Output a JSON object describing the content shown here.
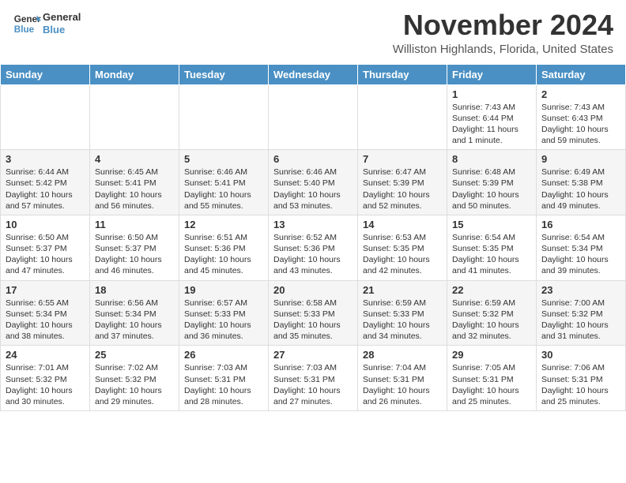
{
  "header": {
    "logo_line1": "General",
    "logo_line2": "Blue",
    "month": "November 2024",
    "location": "Williston Highlands, Florida, United States"
  },
  "weekdays": [
    "Sunday",
    "Monday",
    "Tuesday",
    "Wednesday",
    "Thursday",
    "Friday",
    "Saturday"
  ],
  "weeks": [
    [
      {
        "day": "",
        "content": ""
      },
      {
        "day": "",
        "content": ""
      },
      {
        "day": "",
        "content": ""
      },
      {
        "day": "",
        "content": ""
      },
      {
        "day": "",
        "content": ""
      },
      {
        "day": "1",
        "content": "Sunrise: 7:43 AM\nSunset: 6:44 PM\nDaylight: 11 hours and 1 minute."
      },
      {
        "day": "2",
        "content": "Sunrise: 7:43 AM\nSunset: 6:43 PM\nDaylight: 10 hours and 59 minutes."
      }
    ],
    [
      {
        "day": "3",
        "content": "Sunrise: 6:44 AM\nSunset: 5:42 PM\nDaylight: 10 hours and 57 minutes."
      },
      {
        "day": "4",
        "content": "Sunrise: 6:45 AM\nSunset: 5:41 PM\nDaylight: 10 hours and 56 minutes."
      },
      {
        "day": "5",
        "content": "Sunrise: 6:46 AM\nSunset: 5:41 PM\nDaylight: 10 hours and 55 minutes."
      },
      {
        "day": "6",
        "content": "Sunrise: 6:46 AM\nSunset: 5:40 PM\nDaylight: 10 hours and 53 minutes."
      },
      {
        "day": "7",
        "content": "Sunrise: 6:47 AM\nSunset: 5:39 PM\nDaylight: 10 hours and 52 minutes."
      },
      {
        "day": "8",
        "content": "Sunrise: 6:48 AM\nSunset: 5:39 PM\nDaylight: 10 hours and 50 minutes."
      },
      {
        "day": "9",
        "content": "Sunrise: 6:49 AM\nSunset: 5:38 PM\nDaylight: 10 hours and 49 minutes."
      }
    ],
    [
      {
        "day": "10",
        "content": "Sunrise: 6:50 AM\nSunset: 5:37 PM\nDaylight: 10 hours and 47 minutes."
      },
      {
        "day": "11",
        "content": "Sunrise: 6:50 AM\nSunset: 5:37 PM\nDaylight: 10 hours and 46 minutes."
      },
      {
        "day": "12",
        "content": "Sunrise: 6:51 AM\nSunset: 5:36 PM\nDaylight: 10 hours and 45 minutes."
      },
      {
        "day": "13",
        "content": "Sunrise: 6:52 AM\nSunset: 5:36 PM\nDaylight: 10 hours and 43 minutes."
      },
      {
        "day": "14",
        "content": "Sunrise: 6:53 AM\nSunset: 5:35 PM\nDaylight: 10 hours and 42 minutes."
      },
      {
        "day": "15",
        "content": "Sunrise: 6:54 AM\nSunset: 5:35 PM\nDaylight: 10 hours and 41 minutes."
      },
      {
        "day": "16",
        "content": "Sunrise: 6:54 AM\nSunset: 5:34 PM\nDaylight: 10 hours and 39 minutes."
      }
    ],
    [
      {
        "day": "17",
        "content": "Sunrise: 6:55 AM\nSunset: 5:34 PM\nDaylight: 10 hours and 38 minutes."
      },
      {
        "day": "18",
        "content": "Sunrise: 6:56 AM\nSunset: 5:34 PM\nDaylight: 10 hours and 37 minutes."
      },
      {
        "day": "19",
        "content": "Sunrise: 6:57 AM\nSunset: 5:33 PM\nDaylight: 10 hours and 36 minutes."
      },
      {
        "day": "20",
        "content": "Sunrise: 6:58 AM\nSunset: 5:33 PM\nDaylight: 10 hours and 35 minutes."
      },
      {
        "day": "21",
        "content": "Sunrise: 6:59 AM\nSunset: 5:33 PM\nDaylight: 10 hours and 34 minutes."
      },
      {
        "day": "22",
        "content": "Sunrise: 6:59 AM\nSunset: 5:32 PM\nDaylight: 10 hours and 32 minutes."
      },
      {
        "day": "23",
        "content": "Sunrise: 7:00 AM\nSunset: 5:32 PM\nDaylight: 10 hours and 31 minutes."
      }
    ],
    [
      {
        "day": "24",
        "content": "Sunrise: 7:01 AM\nSunset: 5:32 PM\nDaylight: 10 hours and 30 minutes."
      },
      {
        "day": "25",
        "content": "Sunrise: 7:02 AM\nSunset: 5:32 PM\nDaylight: 10 hours and 29 minutes."
      },
      {
        "day": "26",
        "content": "Sunrise: 7:03 AM\nSunset: 5:31 PM\nDaylight: 10 hours and 28 minutes."
      },
      {
        "day": "27",
        "content": "Sunrise: 7:03 AM\nSunset: 5:31 PM\nDaylight: 10 hours and 27 minutes."
      },
      {
        "day": "28",
        "content": "Sunrise: 7:04 AM\nSunset: 5:31 PM\nDaylight: 10 hours and 26 minutes."
      },
      {
        "day": "29",
        "content": "Sunrise: 7:05 AM\nSunset: 5:31 PM\nDaylight: 10 hours and 25 minutes."
      },
      {
        "day": "30",
        "content": "Sunrise: 7:06 AM\nSunset: 5:31 PM\nDaylight: 10 hours and 25 minutes."
      }
    ]
  ]
}
